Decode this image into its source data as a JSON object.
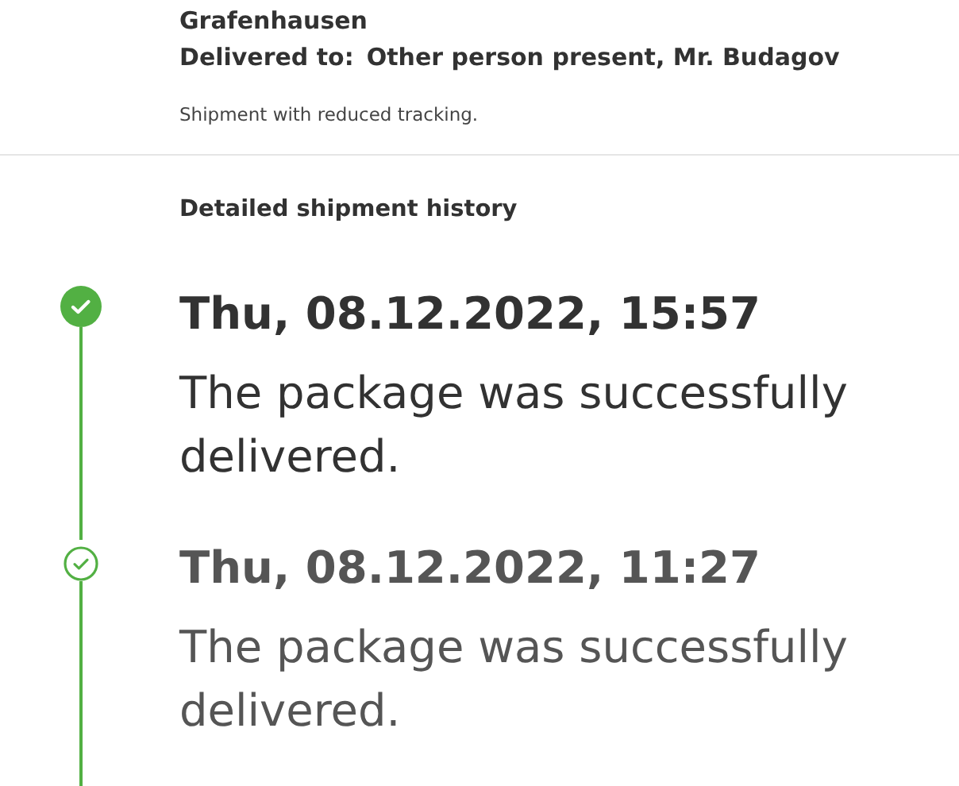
{
  "address": {
    "city": "Grafenhausen",
    "delivered_label": "Delivered to:",
    "delivered_value": "Other person present, Mr. Budagov",
    "note": "Shipment with reduced tracking."
  },
  "history": {
    "title": "Detailed shipment history",
    "events": [
      {
        "time": "Thu, 08.12.2022, 15:57",
        "text": "The package was successfully delivered.",
        "latest": true
      },
      {
        "time": "Thu, 08.12.2022, 11:27",
        "text": "The package was successfully delivered.",
        "latest": false
      }
    ]
  }
}
